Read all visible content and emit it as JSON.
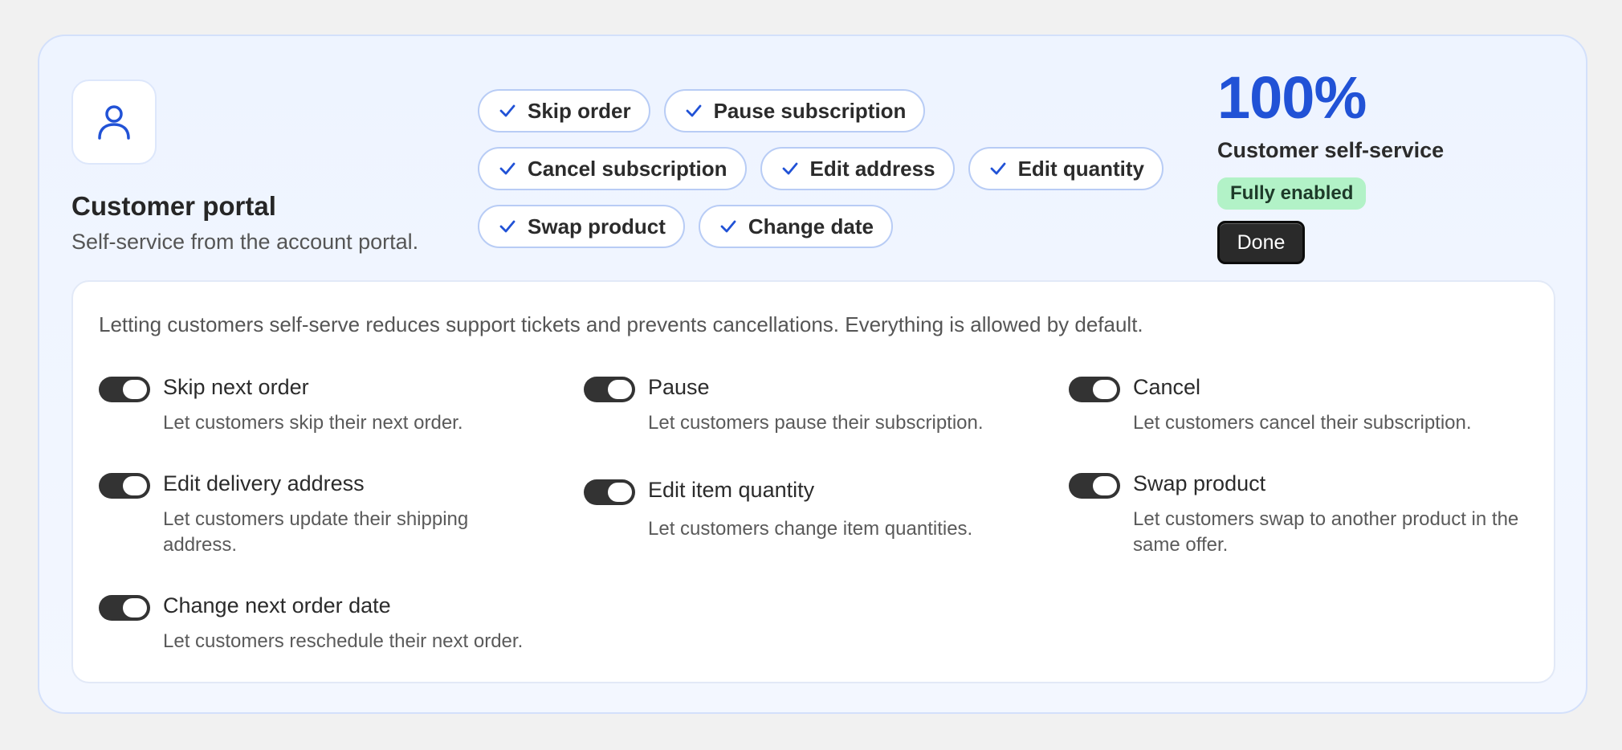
{
  "portal": {
    "title": "Customer portal",
    "subtitle": "Self-service from the account portal."
  },
  "chips": {
    "row1": [
      "Skip order",
      "Pause subscription"
    ],
    "row2": [
      "Cancel subscription",
      "Edit address",
      "Edit quantity"
    ],
    "row3": [
      "Swap product",
      "Change date"
    ]
  },
  "stat": {
    "percent": "100%",
    "label": "Customer self-service",
    "badge": "Fully enabled",
    "done_label": "Done"
  },
  "panel": {
    "intro": "Letting customers self-serve reduces support tickets and prevents cancellations. Everything is allowed by default.",
    "options": [
      {
        "title": "Skip next order",
        "desc": "Let customers skip their next order.",
        "enabled": true
      },
      {
        "title": "Pause",
        "desc": "Let customers pause their subscription.",
        "enabled": true
      },
      {
        "title": "Cancel",
        "desc": "Let customers cancel their subscription.",
        "enabled": true
      },
      {
        "title": "Edit delivery address",
        "desc": "Let customers update their shipping address.",
        "enabled": true
      },
      {
        "title": "Edit item quantity",
        "desc": "Let customers change item quantities.",
        "enabled": true
      },
      {
        "title": "Swap product",
        "desc": "Let customers swap to another product in the same offer.",
        "enabled": true
      },
      {
        "title": "Change next order date",
        "desc": "Let customers reschedule their next order.",
        "enabled": true
      }
    ]
  },
  "colors": {
    "accent": "#2152d6",
    "badge_bg": "#b2f2c7",
    "toggle_on": "#333333"
  },
  "icons": {
    "avatar": "user-icon",
    "chip": "check-icon"
  }
}
